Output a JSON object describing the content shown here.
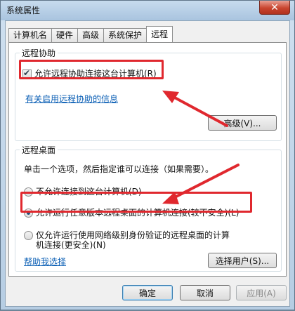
{
  "window": {
    "title": "系统属性",
    "close_label": "✕"
  },
  "tabs": [
    {
      "label": "计算机名",
      "active": false
    },
    {
      "label": "硬件",
      "active": false
    },
    {
      "label": "高级",
      "active": false
    },
    {
      "label": "系统保护",
      "active": false
    },
    {
      "label": "远程",
      "active": true
    }
  ],
  "remote_assistance": {
    "title": "远程协助",
    "checkbox_label": "允许远程协助连接这台计算机(R)",
    "checked": true,
    "info_link": "有关启用远程协助的信息",
    "advanced_button": "高级(V)..."
  },
  "remote_desktop": {
    "title": "远程桌面",
    "instruction": "单击一个选项，然后指定谁可以连接（如果需要）。",
    "options": [
      {
        "label": "不允许连接到这台计算机(D)",
        "selected": false
      },
      {
        "label": "允许运行任意版本远程桌面的计算机连接(较不安全)(L)",
        "selected": true
      },
      {
        "label_line1": "仅允许运行使用网络级别身份验证的远程桌面的计算",
        "label_line2": "机连接(更安全)(N)",
        "selected": false
      }
    ],
    "help_link": "帮助我选择",
    "select_users_button": "选择用户(S)..."
  },
  "footer": {
    "ok": "确定",
    "cancel": "取消",
    "apply": "应用(A)"
  },
  "colors": {
    "highlight_box": "#e0282e",
    "link": "#0b5fb5"
  }
}
